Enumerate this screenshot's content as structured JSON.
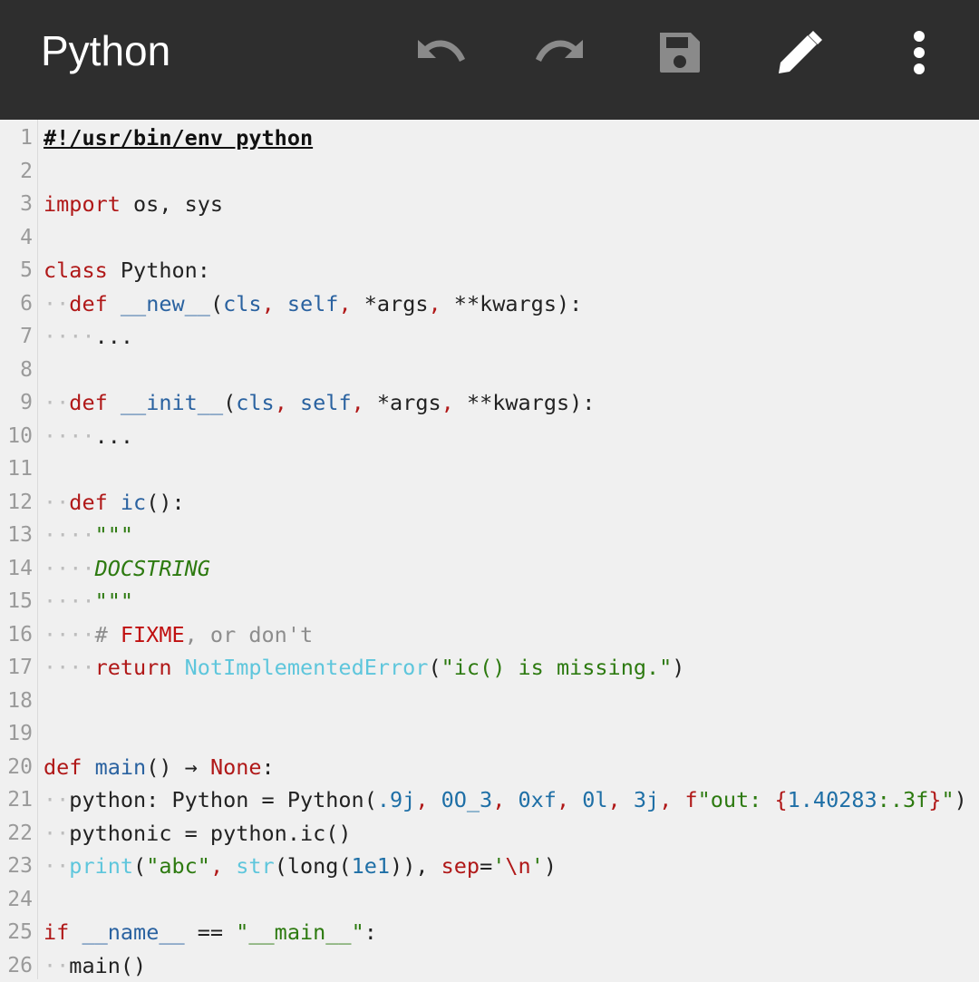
{
  "toolbar": {
    "title": "Python",
    "icons": [
      "undo-icon",
      "redo-icon",
      "save-icon",
      "edit-icon",
      "more-vert-icon"
    ],
    "background": "#2e2e2e"
  },
  "editor": {
    "language": "Python",
    "lines": [
      {
        "n": "1",
        "tokens": [
          {
            "t": "#!/usr/bin/env python",
            "c": "sh"
          }
        ]
      },
      {
        "n": "2",
        "tokens": []
      },
      {
        "n": "3",
        "tokens": [
          {
            "t": "import",
            "c": "k"
          },
          {
            "t": " os, sys",
            "c": ""
          }
        ]
      },
      {
        "n": "4",
        "tokens": []
      },
      {
        "n": "5",
        "tokens": [
          {
            "t": "class",
            "c": "k"
          },
          {
            "t": " Python:",
            "c": ""
          }
        ]
      },
      {
        "n": "6",
        "tokens": [
          {
            "t": "··",
            "c": "ws"
          },
          {
            "t": "def",
            "c": "k"
          },
          {
            "t": " ",
            "c": ""
          },
          {
            "t": "__new__",
            "c": "fn"
          },
          {
            "t": "(",
            "c": ""
          },
          {
            "t": "cls",
            "c": "sf"
          },
          {
            "t": ", ",
            "c": "k"
          },
          {
            "t": "self",
            "c": "sf"
          },
          {
            "t": ", ",
            "c": "k"
          },
          {
            "t": "*args",
            "c": ""
          },
          {
            "t": ", ",
            "c": "k"
          },
          {
            "t": "**kwargs):",
            "c": ""
          }
        ]
      },
      {
        "n": "7",
        "tokens": [
          {
            "t": "····",
            "c": "ws"
          },
          {
            "t": "...",
            "c": ""
          }
        ]
      },
      {
        "n": "8",
        "tokens": []
      },
      {
        "n": "9",
        "tokens": [
          {
            "t": "··",
            "c": "ws"
          },
          {
            "t": "def",
            "c": "k"
          },
          {
            "t": " ",
            "c": ""
          },
          {
            "t": "__init__",
            "c": "fn"
          },
          {
            "t": "(",
            "c": ""
          },
          {
            "t": "cls",
            "c": "sf"
          },
          {
            "t": ", ",
            "c": "k"
          },
          {
            "t": "self",
            "c": "sf"
          },
          {
            "t": ", ",
            "c": "k"
          },
          {
            "t": "*args",
            "c": ""
          },
          {
            "t": ", ",
            "c": "k"
          },
          {
            "t": "**kwargs):",
            "c": ""
          }
        ]
      },
      {
        "n": "10",
        "tokens": [
          {
            "t": "····",
            "c": "ws"
          },
          {
            "t": "...",
            "c": ""
          }
        ]
      },
      {
        "n": "11",
        "tokens": []
      },
      {
        "n": "12",
        "tokens": [
          {
            "t": "··",
            "c": "ws"
          },
          {
            "t": "def",
            "c": "k"
          },
          {
            "t": " ",
            "c": ""
          },
          {
            "t": "ic",
            "c": "fn"
          },
          {
            "t": "():",
            "c": ""
          }
        ]
      },
      {
        "n": "13",
        "tokens": [
          {
            "t": "····",
            "c": "ws"
          },
          {
            "t": "\"\"\"",
            "c": "doc"
          }
        ]
      },
      {
        "n": "14",
        "tokens": [
          {
            "t": "····",
            "c": "ws"
          },
          {
            "t": "DOCSTRING",
            "c": "doc"
          }
        ]
      },
      {
        "n": "15",
        "tokens": [
          {
            "t": "····",
            "c": "ws"
          },
          {
            "t": "\"\"\"",
            "c": "doc"
          }
        ]
      },
      {
        "n": "16",
        "tokens": [
          {
            "t": "····",
            "c": "ws"
          },
          {
            "t": "# ",
            "c": "cm"
          },
          {
            "t": "FIXME",
            "c": "fx"
          },
          {
            "t": ", or don't",
            "c": "cm"
          }
        ]
      },
      {
        "n": "17",
        "tokens": [
          {
            "t": "····",
            "c": "ws"
          },
          {
            "t": "return",
            "c": "k"
          },
          {
            "t": " ",
            "c": ""
          },
          {
            "t": "NotImplementedError",
            "c": "bi"
          },
          {
            "t": "(",
            "c": ""
          },
          {
            "t": "\"ic() is missing.\"",
            "c": "st"
          },
          {
            "t": ")",
            "c": ""
          }
        ]
      },
      {
        "n": "18",
        "tokens": []
      },
      {
        "n": "19",
        "tokens": []
      },
      {
        "n": "20",
        "tokens": [
          {
            "t": "def",
            "c": "k"
          },
          {
            "t": " ",
            "c": ""
          },
          {
            "t": "main",
            "c": "fn"
          },
          {
            "t": "() → ",
            "c": ""
          },
          {
            "t": "None",
            "c": "k"
          },
          {
            "t": ":",
            "c": ""
          }
        ]
      },
      {
        "n": "21",
        "tokens": [
          {
            "t": "··",
            "c": "ws"
          },
          {
            "t": "python: Python = Python(",
            "c": ""
          },
          {
            "t": ".9j",
            "c": "nm"
          },
          {
            "t": ", ",
            "c": "k"
          },
          {
            "t": "0O_3",
            "c": "nm"
          },
          {
            "t": ", ",
            "c": "k"
          },
          {
            "t": "0xf",
            "c": "nm"
          },
          {
            "t": ", ",
            "c": "k"
          },
          {
            "t": "0l",
            "c": "nm"
          },
          {
            "t": ", ",
            "c": "k"
          },
          {
            "t": "3j",
            "c": "nm"
          },
          {
            "t": ", ",
            "c": "k"
          },
          {
            "t": "f",
            "c": "k"
          },
          {
            "t": "\"out: ",
            "c": "st"
          },
          {
            "t": "{",
            "c": "k"
          },
          {
            "t": "1.40283",
            "c": "nm"
          },
          {
            "t": ":.3f",
            "c": "st"
          },
          {
            "t": "}",
            "c": "k"
          },
          {
            "t": "\"",
            "c": "st"
          },
          {
            "t": ")",
            "c": ""
          }
        ]
      },
      {
        "n": "22",
        "tokens": [
          {
            "t": "··",
            "c": "ws"
          },
          {
            "t": "pythonic = python.ic()",
            "c": ""
          }
        ]
      },
      {
        "n": "23",
        "tokens": [
          {
            "t": "··",
            "c": "ws"
          },
          {
            "t": "print",
            "c": "bi"
          },
          {
            "t": "(",
            "c": ""
          },
          {
            "t": "\"abc\"",
            "c": "st"
          },
          {
            "t": ", ",
            "c": "k"
          },
          {
            "t": "str",
            "c": "bi"
          },
          {
            "t": "(long(",
            "c": ""
          },
          {
            "t": "1e1",
            "c": "nm"
          },
          {
            "t": ")), ",
            "c": ""
          },
          {
            "t": "sep",
            "c": "k"
          },
          {
            "t": "=",
            "c": ""
          },
          {
            "t": "'",
            "c": "st"
          },
          {
            "t": "\\n",
            "c": "k"
          },
          {
            "t": "'",
            "c": "st"
          },
          {
            "t": ")",
            "c": ""
          }
        ]
      },
      {
        "n": "24",
        "tokens": []
      },
      {
        "n": "25",
        "tokens": [
          {
            "t": "if",
            "c": "k"
          },
          {
            "t": " ",
            "c": ""
          },
          {
            "t": "__name__",
            "c": "fn"
          },
          {
            "t": " == ",
            "c": ""
          },
          {
            "t": "\"__main__\"",
            "c": "st"
          },
          {
            "t": ":",
            "c": ""
          }
        ]
      },
      {
        "n": "26",
        "tokens": [
          {
            "t": "··",
            "c": "ws"
          },
          {
            "t": "main()",
            "c": ""
          }
        ]
      }
    ]
  }
}
